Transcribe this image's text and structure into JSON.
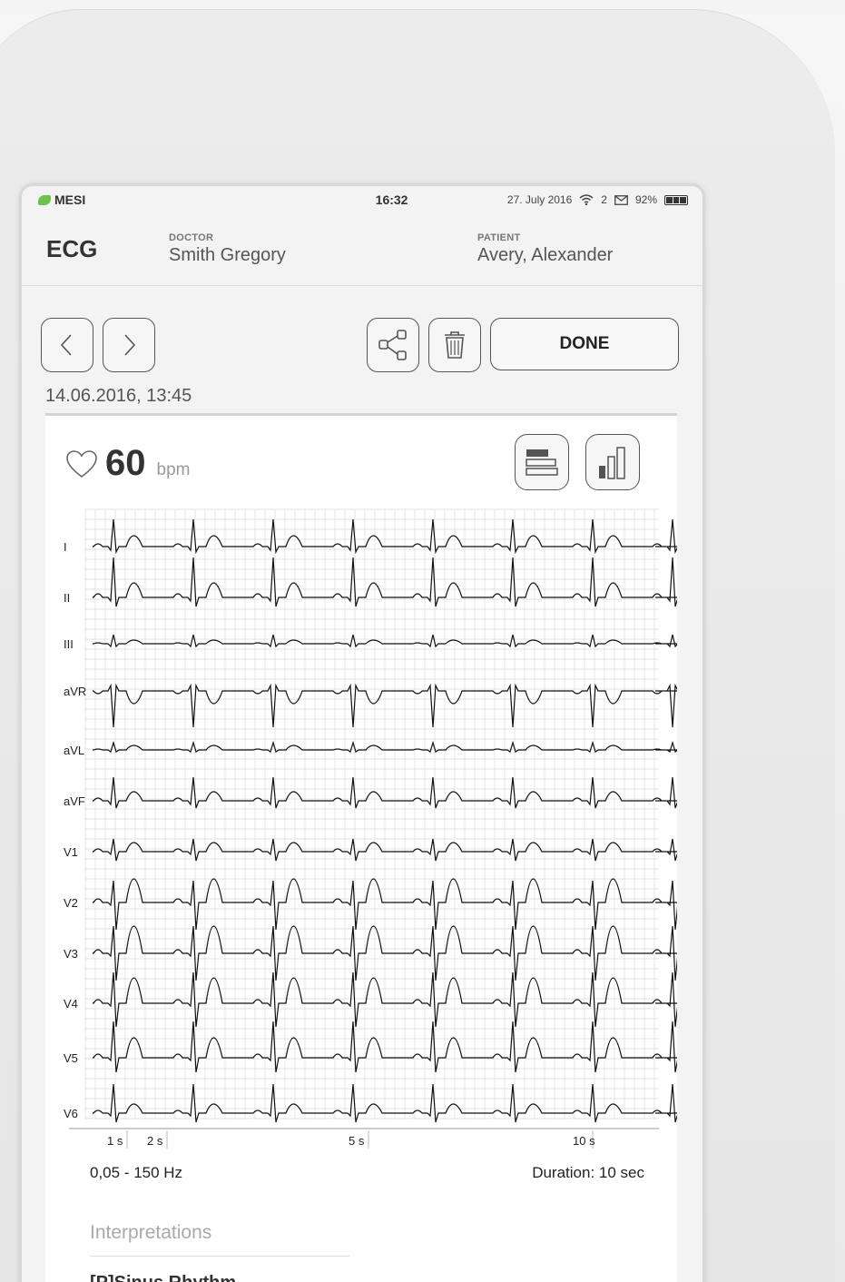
{
  "statusbar": {
    "brand": "MESI",
    "time": "16:32",
    "date": "27. July 2016",
    "mail_count": "2",
    "battery": "92%"
  },
  "header": {
    "title": "ECG",
    "doctor_caption": "DOCTOR",
    "doctor_name": "Smith Gregory",
    "patient_caption": "PATIENT",
    "patient_name": "Avery, Alexander"
  },
  "toolbar": {
    "done_label": "DONE",
    "record_date": "14.06.2016, 13:45"
  },
  "measurement": {
    "heart_rate": "60",
    "unit": "bpm"
  },
  "ecg": {
    "leads": [
      "I",
      "II",
      "III",
      "aVR",
      "aVL",
      "aVF",
      "V1",
      "V2",
      "V3",
      "V4",
      "V5",
      "V6"
    ],
    "beats": 8,
    "time_labels": [
      "1 s",
      "2 s",
      "5 s",
      "10 s"
    ],
    "filter": "0,05 - 150 Hz",
    "duration": "Duration: 10 sec"
  },
  "interpretations": {
    "title": "Interpretations",
    "first_item": "[P]Sinus Rhythm"
  },
  "colors": {
    "grid": "#d9d9d9",
    "trace": "#111111",
    "brand_green": "#6cc24a"
  }
}
